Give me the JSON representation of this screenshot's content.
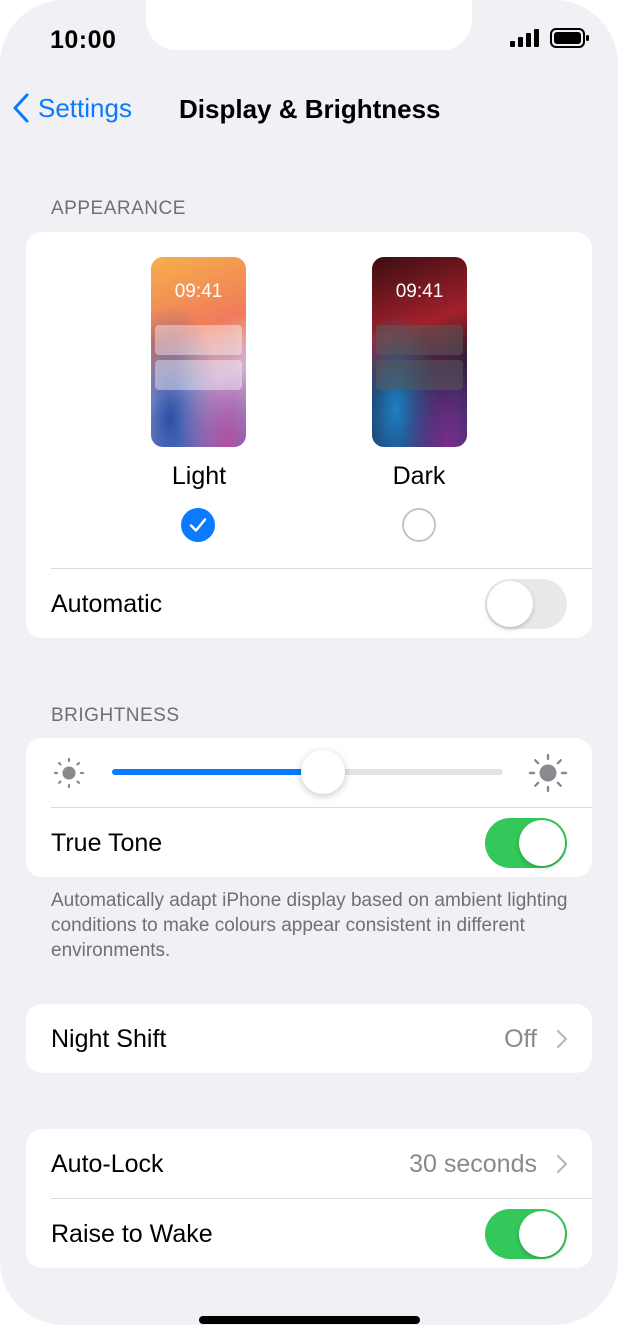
{
  "status_bar": {
    "time": "10:00"
  },
  "nav": {
    "back_label": "Settings",
    "title": "Display & Brightness"
  },
  "appearance": {
    "section_label": "APPEARANCE",
    "options": [
      {
        "label": "Light",
        "preview_time": "09:41",
        "selected": true
      },
      {
        "label": "Dark",
        "preview_time": "09:41",
        "selected": false
      }
    ],
    "automatic": {
      "label": "Automatic",
      "on": false
    }
  },
  "brightness": {
    "section_label": "BRIGHTNESS",
    "level": 0.54,
    "true_tone": {
      "label": "True Tone",
      "on": true
    },
    "footer": "Automatically adapt iPhone display based on ambient lighting conditions to make colours appear consistent in different environments."
  },
  "night_shift": {
    "label": "Night Shift",
    "value": "Off"
  },
  "auto_lock": {
    "label": "Auto-Lock",
    "value": "30 seconds"
  },
  "raise_to_wake": {
    "label": "Raise to Wake",
    "on": true
  },
  "colors": {
    "accent": "#0a7aff",
    "toggle_on": "#34c759",
    "toggle_off": "#e9e9eb",
    "background": "#f0f0f5"
  }
}
